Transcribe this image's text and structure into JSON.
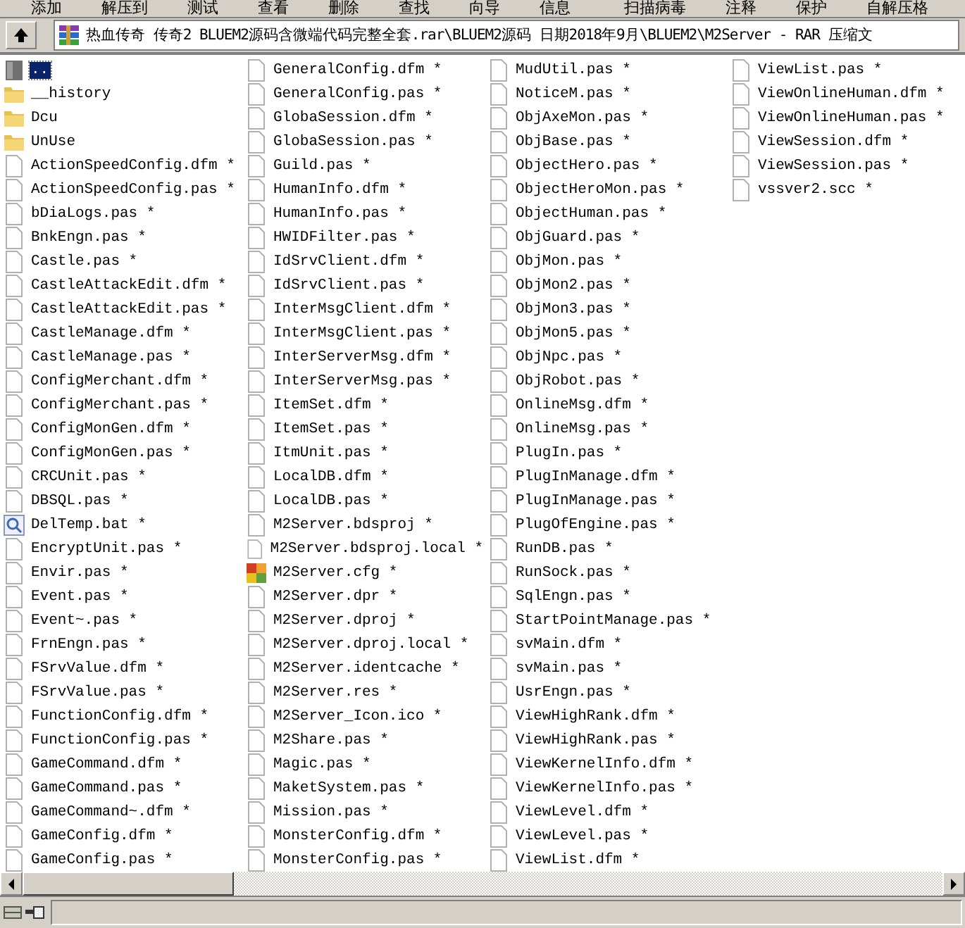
{
  "toolbar": {
    "buttons": [
      "添加",
      "解压到",
      "测试",
      "查看",
      "删除",
      "查找",
      "向导",
      "信息",
      "扫描病毒",
      "注释",
      "保护",
      "自解压格"
    ]
  },
  "address_bar": {
    "path": "热血传奇 传奇2 BLUEM2源码含微端代码完整全套.rar\\BLUEM2源码 日期2018年9月\\BLUEM2\\M2Server - RAR 压缩文"
  },
  "files": [
    {
      "name": "..",
      "kind": "up",
      "selected": true
    },
    {
      "name": "__history",
      "kind": "folder",
      "selected": false
    },
    {
      "name": "Dcu",
      "kind": "folder",
      "selected": false
    },
    {
      "name": "UnUse",
      "kind": "folder",
      "selected": false
    },
    {
      "name": "ActionSpeedConfig.dfm *",
      "kind": "file",
      "selected": false
    },
    {
      "name": "ActionSpeedConfig.pas *",
      "kind": "file",
      "selected": false
    },
    {
      "name": "bDiaLogs.pas *",
      "kind": "file",
      "selected": false
    },
    {
      "name": "BnkEngn.pas *",
      "kind": "file",
      "selected": false
    },
    {
      "name": "Castle.pas *",
      "kind": "file",
      "selected": false
    },
    {
      "name": "CastleAttackEdit.dfm *",
      "kind": "file",
      "selected": false
    },
    {
      "name": "CastleAttackEdit.pas *",
      "kind": "file",
      "selected": false
    },
    {
      "name": "CastleManage.dfm *",
      "kind": "file",
      "selected": false
    },
    {
      "name": "CastleManage.pas *",
      "kind": "file",
      "selected": false
    },
    {
      "name": "ConfigMerchant.dfm *",
      "kind": "file",
      "selected": false
    },
    {
      "name": "ConfigMerchant.pas *",
      "kind": "file",
      "selected": false
    },
    {
      "name": "ConfigMonGen.dfm *",
      "kind": "file",
      "selected": false
    },
    {
      "name": "ConfigMonGen.pas *",
      "kind": "file",
      "selected": false
    },
    {
      "name": "CRCUnit.pas *",
      "kind": "file",
      "selected": false
    },
    {
      "name": "DBSQL.pas *",
      "kind": "file",
      "selected": false
    },
    {
      "name": "DelTemp.bat *",
      "kind": "batch",
      "selected": false
    },
    {
      "name": "EncryptUnit.pas *",
      "kind": "file",
      "selected": false
    },
    {
      "name": "Envir.pas *",
      "kind": "file",
      "selected": false
    },
    {
      "name": "Event.pas *",
      "kind": "file",
      "selected": false
    },
    {
      "name": "Event~.pas *",
      "kind": "file",
      "selected": false
    },
    {
      "name": "FrnEngn.pas *",
      "kind": "file",
      "selected": false
    },
    {
      "name": "FSrvValue.dfm *",
      "kind": "file",
      "selected": false
    },
    {
      "name": "FSrvValue.pas *",
      "kind": "file",
      "selected": false
    },
    {
      "name": "FunctionConfig.dfm *",
      "kind": "file",
      "selected": false
    },
    {
      "name": "FunctionConfig.pas *",
      "kind": "file",
      "selected": false
    },
    {
      "name": "GameCommand.dfm *",
      "kind": "file",
      "selected": false
    },
    {
      "name": "GameCommand.pas *",
      "kind": "file",
      "selected": false
    },
    {
      "name": "GameCommand~.dfm *",
      "kind": "file",
      "selected": false
    },
    {
      "name": "GameConfig.dfm *",
      "kind": "file",
      "selected": false
    },
    {
      "name": "GameConfig.pas *",
      "kind": "file",
      "selected": false
    },
    {
      "name": "GeneralConfig.dfm *",
      "kind": "file",
      "selected": false
    },
    {
      "name": "GeneralConfig.pas *",
      "kind": "file",
      "selected": false
    },
    {
      "name": "GlobaSession.dfm *",
      "kind": "file",
      "selected": false
    },
    {
      "name": "GlobaSession.pas *",
      "kind": "file",
      "selected": false
    },
    {
      "name": "Guild.pas *",
      "kind": "file",
      "selected": false
    },
    {
      "name": "HumanInfo.dfm *",
      "kind": "file",
      "selected": false
    },
    {
      "name": "HumanInfo.pas *",
      "kind": "file",
      "selected": false
    },
    {
      "name": "HWIDFilter.pas *",
      "kind": "file",
      "selected": false
    },
    {
      "name": "IdSrvClient.dfm *",
      "kind": "file",
      "selected": false
    },
    {
      "name": "IdSrvClient.pas *",
      "kind": "file",
      "selected": false
    },
    {
      "name": "InterMsgClient.dfm *",
      "kind": "file",
      "selected": false
    },
    {
      "name": "InterMsgClient.pas *",
      "kind": "file",
      "selected": false
    },
    {
      "name": "InterServerMsg.dfm *",
      "kind": "file",
      "selected": false
    },
    {
      "name": "InterServerMsg.pas *",
      "kind": "file",
      "selected": false
    },
    {
      "name": "ItemSet.dfm *",
      "kind": "file",
      "selected": false
    },
    {
      "name": "ItemSet.pas *",
      "kind": "file",
      "selected": false
    },
    {
      "name": "ItmUnit.pas *",
      "kind": "file",
      "selected": false
    },
    {
      "name": "LocalDB.dfm *",
      "kind": "file",
      "selected": false
    },
    {
      "name": "LocalDB.pas *",
      "kind": "file",
      "selected": false
    },
    {
      "name": "M2Server.bdsproj *",
      "kind": "file",
      "selected": false
    },
    {
      "name": "M2Server.bdsproj.local *",
      "kind": "file",
      "selected": false
    },
    {
      "name": "M2Server.cfg *",
      "kind": "config",
      "selected": false
    },
    {
      "name": "M2Server.dpr *",
      "kind": "file",
      "selected": false
    },
    {
      "name": "M2Server.dproj *",
      "kind": "file",
      "selected": false
    },
    {
      "name": "M2Server.dproj.local *",
      "kind": "file",
      "selected": false
    },
    {
      "name": "M2Server.identcache *",
      "kind": "file",
      "selected": false
    },
    {
      "name": "M2Server.res *",
      "kind": "file",
      "selected": false
    },
    {
      "name": "M2Server_Icon.ico *",
      "kind": "file",
      "selected": false
    },
    {
      "name": "M2Share.pas *",
      "kind": "file",
      "selected": false
    },
    {
      "name": "Magic.pas *",
      "kind": "file",
      "selected": false
    },
    {
      "name": "MaketSystem.pas *",
      "kind": "file",
      "selected": false
    },
    {
      "name": "Mission.pas *",
      "kind": "file",
      "selected": false
    },
    {
      "name": "MonsterConfig.dfm *",
      "kind": "file",
      "selected": false
    },
    {
      "name": "MonsterConfig.pas *",
      "kind": "file",
      "selected": false
    },
    {
      "name": "MudUtil.pas *",
      "kind": "file",
      "selected": false
    },
    {
      "name": "NoticeM.pas *",
      "kind": "file",
      "selected": false
    },
    {
      "name": "ObjAxeMon.pas *",
      "kind": "file",
      "selected": false
    },
    {
      "name": "ObjBase.pas *",
      "kind": "file",
      "selected": false
    },
    {
      "name": "ObjectHero.pas *",
      "kind": "file",
      "selected": false
    },
    {
      "name": "ObjectHeroMon.pas *",
      "kind": "file",
      "selected": false
    },
    {
      "name": "ObjectHuman.pas *",
      "kind": "file",
      "selected": false
    },
    {
      "name": "ObjGuard.pas *",
      "kind": "file",
      "selected": false
    },
    {
      "name": "ObjMon.pas *",
      "kind": "file",
      "selected": false
    },
    {
      "name": "ObjMon2.pas *",
      "kind": "file",
      "selected": false
    },
    {
      "name": "ObjMon3.pas *",
      "kind": "file",
      "selected": false
    },
    {
      "name": "ObjMon5.pas *",
      "kind": "file",
      "selected": false
    },
    {
      "name": "ObjNpc.pas *",
      "kind": "file",
      "selected": false
    },
    {
      "name": "ObjRobot.pas *",
      "kind": "file",
      "selected": false
    },
    {
      "name": "OnlineMsg.dfm *",
      "kind": "file",
      "selected": false
    },
    {
      "name": "OnlineMsg.pas *",
      "kind": "file",
      "selected": false
    },
    {
      "name": "PlugIn.pas *",
      "kind": "file",
      "selected": false
    },
    {
      "name": "PlugInManage.dfm *",
      "kind": "file",
      "selected": false
    },
    {
      "name": "PlugInManage.pas *",
      "kind": "file",
      "selected": false
    },
    {
      "name": "PlugOfEngine.pas *",
      "kind": "file",
      "selected": false
    },
    {
      "name": "RunDB.pas *",
      "kind": "file",
      "selected": false
    },
    {
      "name": "RunSock.pas *",
      "kind": "file",
      "selected": false
    },
    {
      "name": "SqlEngn.pas *",
      "kind": "file",
      "selected": false
    },
    {
      "name": "StartPointManage.pas *",
      "kind": "file",
      "selected": false
    },
    {
      "name": "svMain.dfm *",
      "kind": "file",
      "selected": false
    },
    {
      "name": "svMain.pas *",
      "kind": "file",
      "selected": false
    },
    {
      "name": "UsrEngn.pas *",
      "kind": "file",
      "selected": false
    },
    {
      "name": "ViewHighRank.dfm *",
      "kind": "file",
      "selected": false
    },
    {
      "name": "ViewHighRank.pas *",
      "kind": "file",
      "selected": false
    },
    {
      "name": "ViewKernelInfo.dfm *",
      "kind": "file",
      "selected": false
    },
    {
      "name": "ViewKernelInfo.pas *",
      "kind": "file",
      "selected": false
    },
    {
      "name": "ViewLevel.dfm *",
      "kind": "file",
      "selected": false
    },
    {
      "name": "ViewLevel.pas *",
      "kind": "file",
      "selected": false
    },
    {
      "name": "ViewList.dfm *",
      "kind": "file",
      "selected": false
    },
    {
      "name": "ViewList.pas *",
      "kind": "file",
      "selected": false
    },
    {
      "name": "ViewOnlineHuman.dfm *",
      "kind": "file",
      "selected": false
    },
    {
      "name": "ViewOnlineHuman.pas *",
      "kind": "file",
      "selected": false
    },
    {
      "name": "ViewSession.dfm *",
      "kind": "file",
      "selected": false
    },
    {
      "name": "ViewSession.pas *",
      "kind": "file",
      "selected": false
    },
    {
      "name": "vssver2.scc *",
      "kind": "file",
      "selected": false
    }
  ]
}
